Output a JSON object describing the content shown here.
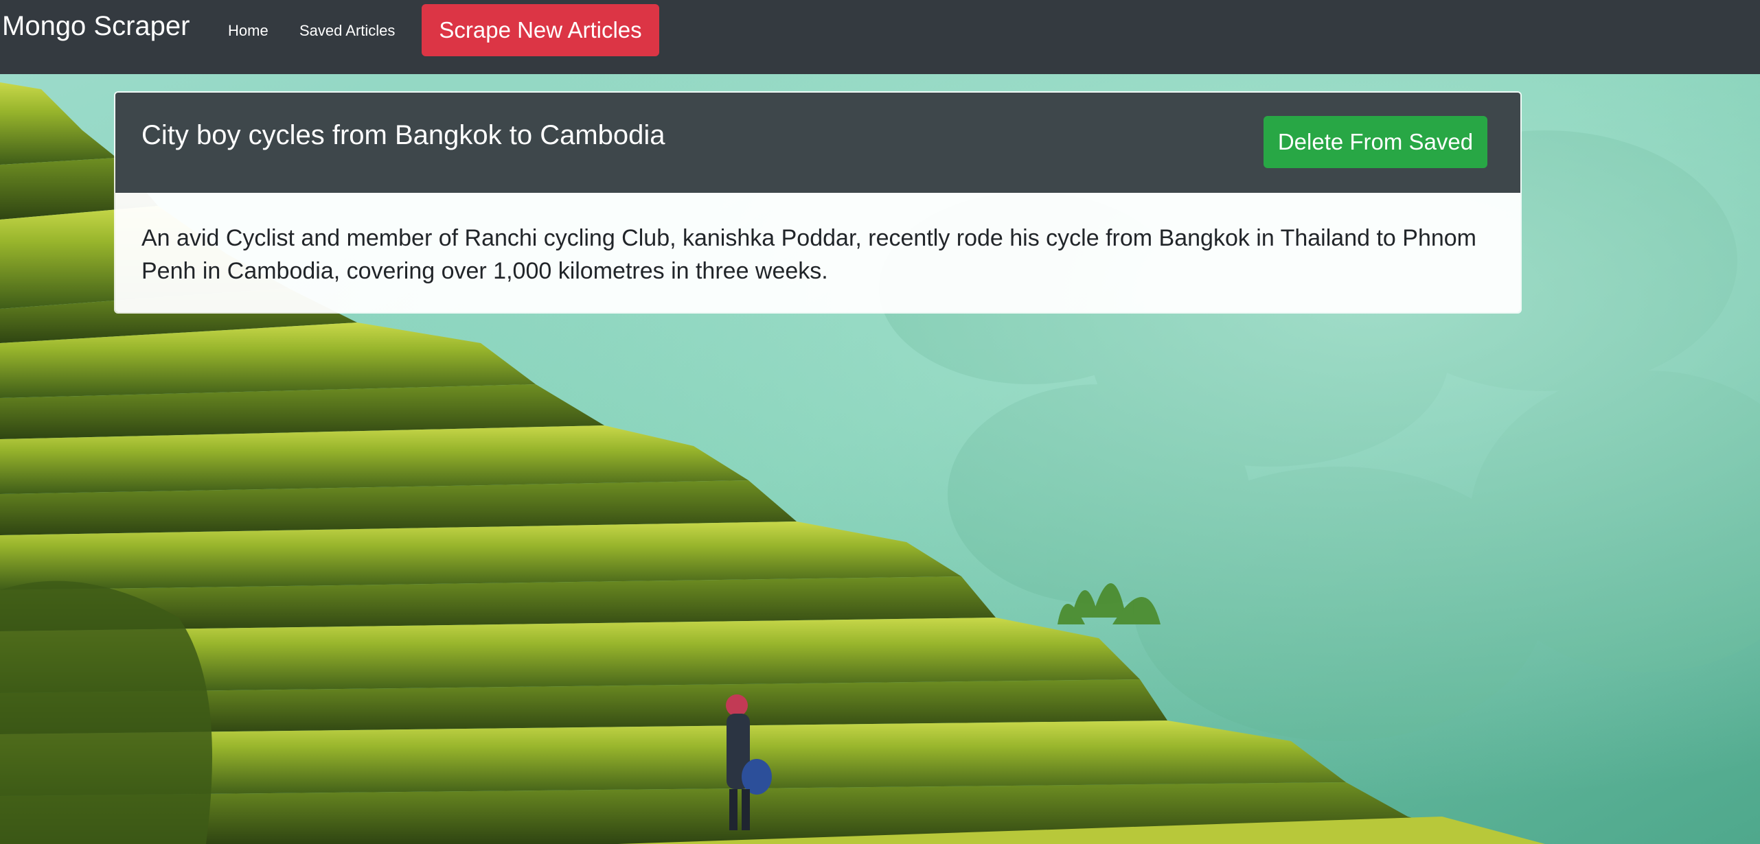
{
  "navbar": {
    "brand": "Mongo Scraper",
    "links": [
      {
        "label": "Home"
      },
      {
        "label": "Saved Articles"
      }
    ],
    "scrape_button_label": "Scrape New Articles"
  },
  "article": {
    "title": "City boy cycles from Bangkok to Cambodia",
    "delete_button_label": "Delete From Saved",
    "summary": "An avid Cyclist and member of Ranchi cycling Club, kanishka Poddar, recently rode his cycle from Bangkok in Thailand to Phnom Penh in Cambodia, covering over 1,000 kilometres in three weeks."
  },
  "colors": {
    "navbar": "#343a40",
    "danger_button": "#dc3545",
    "success_button": "#28a745",
    "card_header": "#3e474b"
  }
}
